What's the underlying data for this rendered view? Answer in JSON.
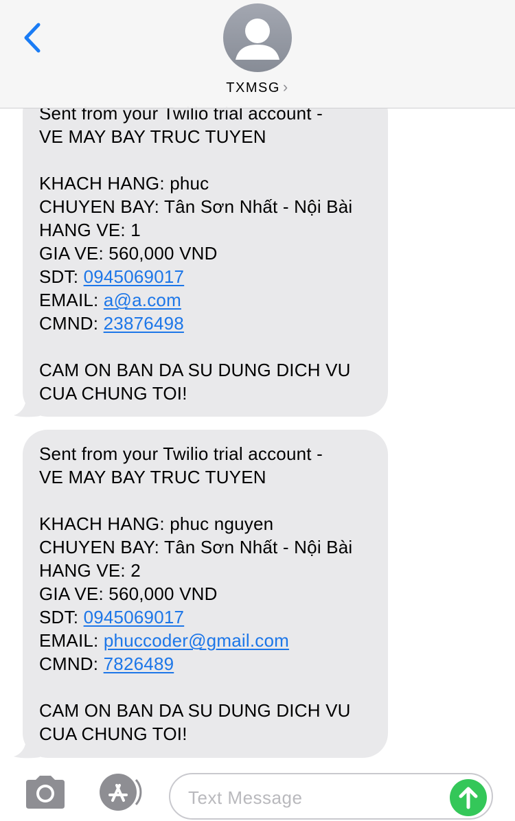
{
  "header": {
    "back_icon": "chevron-left-icon",
    "contact_name": "TXMSG",
    "contact_chevron": "›"
  },
  "messages": [
    {
      "lines": [
        {
          "type": "text",
          "text": "Sent from your Twilio trial account -"
        },
        {
          "type": "text",
          "text": "VE MAY BAY TRUC TUYEN"
        },
        {
          "type": "blank"
        },
        {
          "type": "text",
          "text": "KHACH HANG: phuc"
        },
        {
          "type": "text",
          "text": "CHUYEN BAY: Tân Sơn Nhất - Nội Bài"
        },
        {
          "type": "text",
          "text": "HANG VE: 1"
        },
        {
          "type": "text",
          "text": "GIA VE: 560,000 VND"
        },
        {
          "type": "link",
          "label": "SDT: ",
          "link": "0945069017"
        },
        {
          "type": "link",
          "label": "EMAIL: ",
          "link": "a@a.com"
        },
        {
          "type": "link",
          "label": "CMND: ",
          "link": "23876498"
        },
        {
          "type": "blank"
        },
        {
          "type": "text",
          "text": "CAM ON BAN DA SU DUNG DICH VU"
        },
        {
          "type": "text",
          "text": "CUA CHUNG TOI!"
        }
      ]
    },
    {
      "lines": [
        {
          "type": "text",
          "text": "Sent from your Twilio trial account -"
        },
        {
          "type": "text",
          "text": "VE MAY BAY TRUC TUYEN"
        },
        {
          "type": "blank"
        },
        {
          "type": "text",
          "text": "KHACH HANG: phuc nguyen"
        },
        {
          "type": "text",
          "text": "CHUYEN BAY: Tân Sơn Nhất - Nội Bài"
        },
        {
          "type": "text",
          "text": "HANG VE: 2"
        },
        {
          "type": "text",
          "text": "GIA VE: 560,000 VND"
        },
        {
          "type": "link",
          "label": "SDT: ",
          "link": "0945069017"
        },
        {
          "type": "link",
          "label": "EMAIL: ",
          "link": "phuccoder@gmail.com"
        },
        {
          "type": "link",
          "label": "CMND: ",
          "link": "7826489"
        },
        {
          "type": "blank"
        },
        {
          "type": "text",
          "text": "CAM ON BAN DA SU DUNG DICH VU"
        },
        {
          "type": "text",
          "text": "CUA CHUNG TOI!"
        }
      ]
    }
  ],
  "composer": {
    "camera_icon": "camera-icon",
    "apps_icon": "app-store-icon",
    "placeholder": "Text Message",
    "send_icon": "arrow-up-icon"
  },
  "colors": {
    "bubble": "#e9e9eb",
    "link": "#1c76e8",
    "send": "#34c759",
    "back": "#1a7cf5"
  }
}
